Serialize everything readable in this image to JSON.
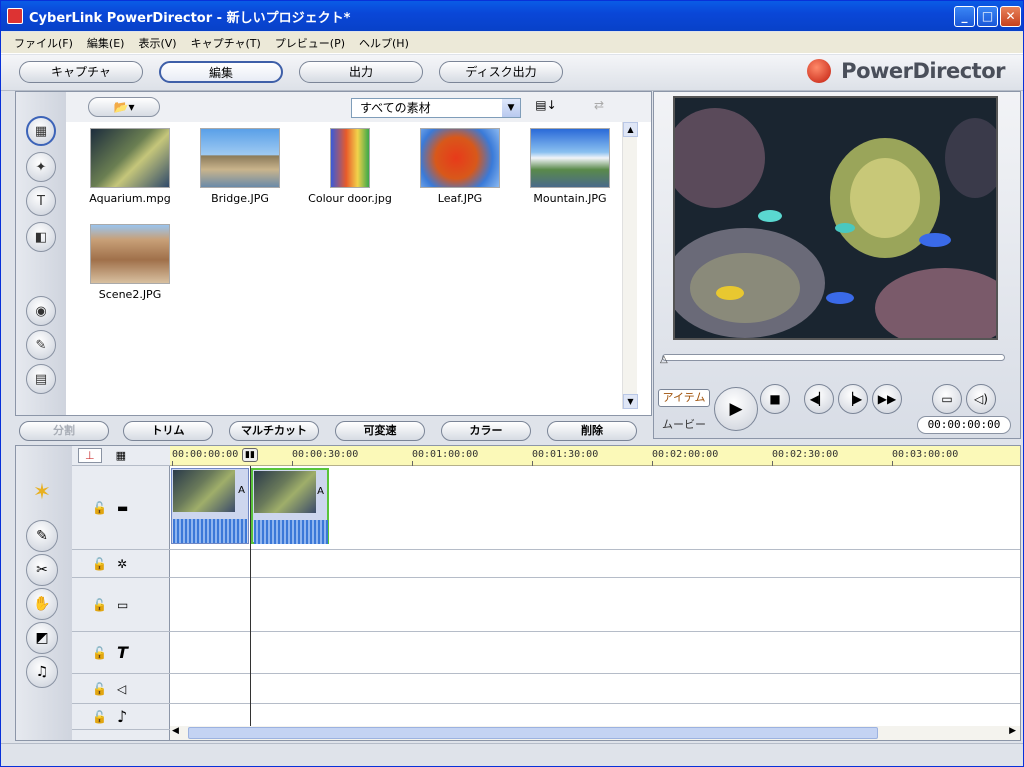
{
  "window": {
    "title": "CyberLink PowerDirector - 新しいプロジェクト*"
  },
  "menu": [
    "ファイル(F)",
    "編集(E)",
    "表示(V)",
    "キャプチャ(T)",
    "プレビュー(P)",
    "ヘルプ(H)"
  ],
  "modes": [
    {
      "label": "キャプチャ",
      "active": false
    },
    {
      "label": "編集",
      "active": true
    },
    {
      "label": "出力",
      "active": false
    },
    {
      "label": "ディスク出力",
      "active": false
    }
  ],
  "brand": "PowerDirector",
  "library": {
    "filter": "すべての素材",
    "items": [
      {
        "name": "Aquarium.mpg"
      },
      {
        "name": "Bridge.JPG"
      },
      {
        "name": "Colour door.jpg"
      },
      {
        "name": "Leaf.JPG"
      },
      {
        "name": "Mountain.JPG"
      },
      {
        "name": "Scene2.JPG"
      }
    ]
  },
  "preview": {
    "mode_item": "アイテム",
    "mode_movie": "ムービー",
    "timecode": "00:00:00:00"
  },
  "edit_toolbar": [
    "分割",
    "トリム",
    "マルチカット",
    "可変速",
    "カラー",
    "削除"
  ],
  "timeline": {
    "ruler": [
      "00:00:00:00",
      "00:00:30:00",
      "00:01:00:00",
      "00:01:30:00",
      "00:02:00:00",
      "00:02:30:00",
      "00:03:00:00"
    ],
    "clip_audio_marker": "A"
  }
}
